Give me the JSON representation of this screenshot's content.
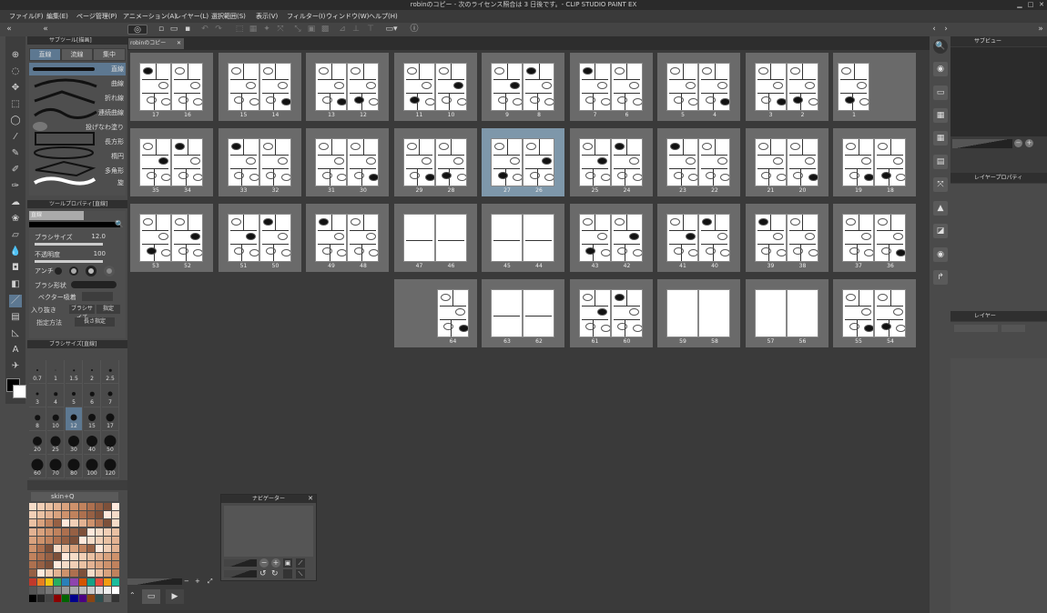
{
  "window": {
    "title": "robinのコピー - 次のライセンス照合は 3 日後です。- CLIP STUDIO PAINT EX"
  },
  "menu": [
    "ファイル(F)",
    "編集(E)",
    "ページ管理(P)",
    "アニメーション(A)",
    "レイヤー(L)",
    "選択範囲(S)",
    "表示(V)",
    "フィルター(I)",
    "ウィンドウ(W)",
    "ヘルプ(H)"
  ],
  "document_tab": {
    "label": "robinのコピー"
  },
  "subtool_panel": {
    "header": "サブツール[描画]",
    "tabs": [
      "直線",
      "流線",
      "集中"
    ],
    "items": [
      "直線",
      "曲線",
      "折れ線",
      "連続曲線",
      "投げなわ塗り",
      "長方形",
      "楕円",
      "多角形",
      "旋"
    ]
  },
  "tool_property": {
    "header": "ツールプロパティ[直線]",
    "title": "直線",
    "brush_size_label": "ブラシサイズ",
    "brush_size_value": "12.0",
    "opacity_label": "不透明度",
    "opacity_value": "100",
    "antialias_label": "アンチ",
    "brush_shape_label": "ブラシ形状",
    "vector_label": "ベクター吸着",
    "entry_label": "入り抜き",
    "entry_value": "ブラシサイズ",
    "entry_mode": "指定",
    "extra_label": "指定方法",
    "extra_value": "長さ指定"
  },
  "brush_size_panel": {
    "header": "ブラシサイズ[直線]",
    "sizes": [
      "0.7",
      "1",
      "1.5",
      "2",
      "2.5",
      "3",
      "4",
      "5",
      "6",
      "7",
      "8",
      "10",
      "12",
      "15",
      "17",
      "20",
      "25",
      "30",
      "40",
      "50",
      "60",
      "70",
      "80",
      "100",
      "120"
    ],
    "selected": "12"
  },
  "color_set": {
    "name": "skin+Q"
  },
  "page_manager": {
    "rows": [
      [
        [
          "17",
          "16"
        ],
        [
          "15",
          "14"
        ],
        [
          "13",
          "12"
        ],
        [
          "11",
          "10"
        ],
        [
          "9",
          "8"
        ],
        [
          "7",
          "6"
        ],
        [
          "5",
          "4"
        ],
        [
          "3",
          "2"
        ],
        [
          "1"
        ]
      ],
      [
        [
          "35",
          "34"
        ],
        [
          "33",
          "32"
        ],
        [
          "31",
          "30"
        ],
        [
          "29",
          "28"
        ],
        [
          "27",
          "26"
        ],
        [
          "25",
          "24"
        ],
        [
          "23",
          "22"
        ],
        [
          "21",
          "20"
        ],
        [
          "19",
          "18"
        ]
      ],
      [
        [
          "53",
          "52"
        ],
        [
          "51",
          "50"
        ],
        [
          "49",
          "48"
        ],
        [
          "47",
          "46"
        ],
        [
          "45",
          "44"
        ],
        [
          "43",
          "42"
        ],
        [
          "41",
          "40"
        ],
        [
          "39",
          "38"
        ],
        [
          "37",
          "36"
        ]
      ],
      [
        [
          "64"
        ],
        [
          "63",
          "62"
        ],
        [
          "61",
          "60"
        ],
        [
          "59",
          "58"
        ],
        [
          "57",
          "56"
        ],
        [
          "55",
          "54"
        ]
      ]
    ],
    "selected_spread": "27-26"
  },
  "navigator": {
    "title": "ナビゲーター"
  },
  "right_panels": {
    "sub_view": "サブビュー",
    "layer_property": "レイヤープロパティ",
    "layer": "レイヤー"
  }
}
